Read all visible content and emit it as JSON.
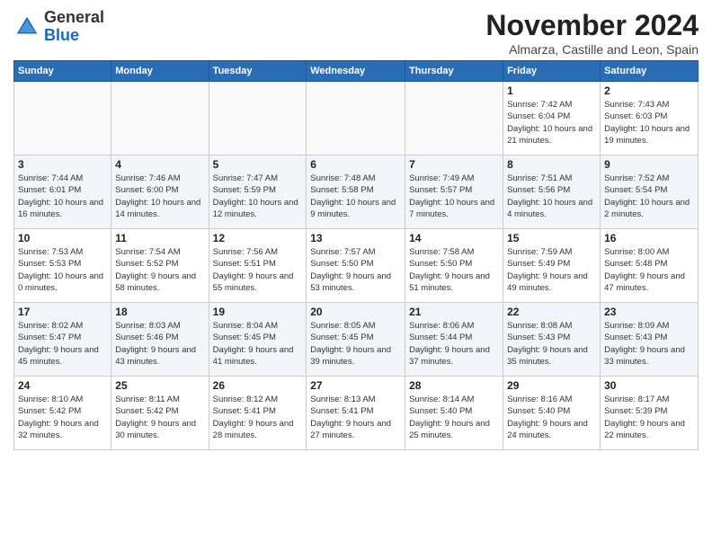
{
  "header": {
    "logo_general": "General",
    "logo_blue": "Blue",
    "month_title": "November 2024",
    "subtitle": "Almarza, Castille and Leon, Spain"
  },
  "calendar": {
    "headers": [
      "Sunday",
      "Monday",
      "Tuesday",
      "Wednesday",
      "Thursday",
      "Friday",
      "Saturday"
    ],
    "weeks": [
      [
        {
          "day": "",
          "info": ""
        },
        {
          "day": "",
          "info": ""
        },
        {
          "day": "",
          "info": ""
        },
        {
          "day": "",
          "info": ""
        },
        {
          "day": "",
          "info": ""
        },
        {
          "day": "1",
          "info": "Sunrise: 7:42 AM\nSunset: 6:04 PM\nDaylight: 10 hours and 21 minutes."
        },
        {
          "day": "2",
          "info": "Sunrise: 7:43 AM\nSunset: 6:03 PM\nDaylight: 10 hours and 19 minutes."
        }
      ],
      [
        {
          "day": "3",
          "info": "Sunrise: 7:44 AM\nSunset: 6:01 PM\nDaylight: 10 hours and 16 minutes."
        },
        {
          "day": "4",
          "info": "Sunrise: 7:46 AM\nSunset: 6:00 PM\nDaylight: 10 hours and 14 minutes."
        },
        {
          "day": "5",
          "info": "Sunrise: 7:47 AM\nSunset: 5:59 PM\nDaylight: 10 hours and 12 minutes."
        },
        {
          "day": "6",
          "info": "Sunrise: 7:48 AM\nSunset: 5:58 PM\nDaylight: 10 hours and 9 minutes."
        },
        {
          "day": "7",
          "info": "Sunrise: 7:49 AM\nSunset: 5:57 PM\nDaylight: 10 hours and 7 minutes."
        },
        {
          "day": "8",
          "info": "Sunrise: 7:51 AM\nSunset: 5:56 PM\nDaylight: 10 hours and 4 minutes."
        },
        {
          "day": "9",
          "info": "Sunrise: 7:52 AM\nSunset: 5:54 PM\nDaylight: 10 hours and 2 minutes."
        }
      ],
      [
        {
          "day": "10",
          "info": "Sunrise: 7:53 AM\nSunset: 5:53 PM\nDaylight: 10 hours and 0 minutes."
        },
        {
          "day": "11",
          "info": "Sunrise: 7:54 AM\nSunset: 5:52 PM\nDaylight: 9 hours and 58 minutes."
        },
        {
          "day": "12",
          "info": "Sunrise: 7:56 AM\nSunset: 5:51 PM\nDaylight: 9 hours and 55 minutes."
        },
        {
          "day": "13",
          "info": "Sunrise: 7:57 AM\nSunset: 5:50 PM\nDaylight: 9 hours and 53 minutes."
        },
        {
          "day": "14",
          "info": "Sunrise: 7:58 AM\nSunset: 5:50 PM\nDaylight: 9 hours and 51 minutes."
        },
        {
          "day": "15",
          "info": "Sunrise: 7:59 AM\nSunset: 5:49 PM\nDaylight: 9 hours and 49 minutes."
        },
        {
          "day": "16",
          "info": "Sunrise: 8:00 AM\nSunset: 5:48 PM\nDaylight: 9 hours and 47 minutes."
        }
      ],
      [
        {
          "day": "17",
          "info": "Sunrise: 8:02 AM\nSunset: 5:47 PM\nDaylight: 9 hours and 45 minutes."
        },
        {
          "day": "18",
          "info": "Sunrise: 8:03 AM\nSunset: 5:46 PM\nDaylight: 9 hours and 43 minutes."
        },
        {
          "day": "19",
          "info": "Sunrise: 8:04 AM\nSunset: 5:45 PM\nDaylight: 9 hours and 41 minutes."
        },
        {
          "day": "20",
          "info": "Sunrise: 8:05 AM\nSunset: 5:45 PM\nDaylight: 9 hours and 39 minutes."
        },
        {
          "day": "21",
          "info": "Sunrise: 8:06 AM\nSunset: 5:44 PM\nDaylight: 9 hours and 37 minutes."
        },
        {
          "day": "22",
          "info": "Sunrise: 8:08 AM\nSunset: 5:43 PM\nDaylight: 9 hours and 35 minutes."
        },
        {
          "day": "23",
          "info": "Sunrise: 8:09 AM\nSunset: 5:43 PM\nDaylight: 9 hours and 33 minutes."
        }
      ],
      [
        {
          "day": "24",
          "info": "Sunrise: 8:10 AM\nSunset: 5:42 PM\nDaylight: 9 hours and 32 minutes."
        },
        {
          "day": "25",
          "info": "Sunrise: 8:11 AM\nSunset: 5:42 PM\nDaylight: 9 hours and 30 minutes."
        },
        {
          "day": "26",
          "info": "Sunrise: 8:12 AM\nSunset: 5:41 PM\nDaylight: 9 hours and 28 minutes."
        },
        {
          "day": "27",
          "info": "Sunrise: 8:13 AM\nSunset: 5:41 PM\nDaylight: 9 hours and 27 minutes."
        },
        {
          "day": "28",
          "info": "Sunrise: 8:14 AM\nSunset: 5:40 PM\nDaylight: 9 hours and 25 minutes."
        },
        {
          "day": "29",
          "info": "Sunrise: 8:16 AM\nSunset: 5:40 PM\nDaylight: 9 hours and 24 minutes."
        },
        {
          "day": "30",
          "info": "Sunrise: 8:17 AM\nSunset: 5:39 PM\nDaylight: 9 hours and 22 minutes."
        }
      ]
    ]
  }
}
